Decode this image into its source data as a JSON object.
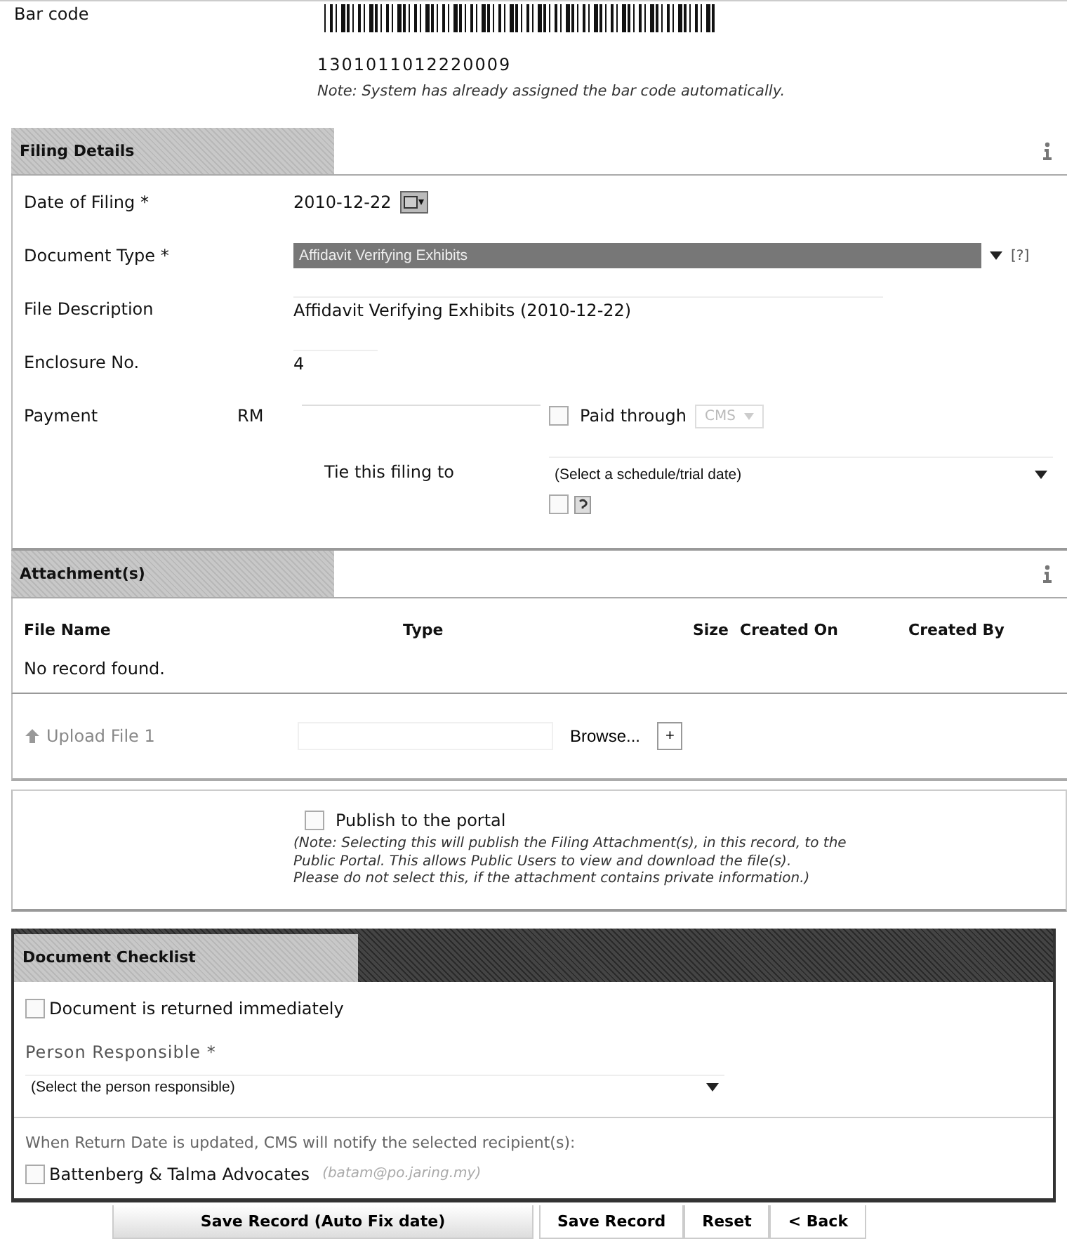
{
  "bar_code": {
    "label": "Bar code",
    "number": "1301011012220009",
    "note": "Note: System has already assigned the bar code automatically."
  },
  "filing_details": {
    "title": "Filing Details",
    "date": {
      "label": "Date of Filing *",
      "value": "2010-12-22"
    },
    "document_type": {
      "label": "Document Type *",
      "value": "Affidavit Verifying Exhibits",
      "help": "[?]"
    },
    "file_description": {
      "label": "File Description",
      "value": "Affidavit Verifying Exhibits (2010-12-22)"
    },
    "enclosure": {
      "label": "Enclosure No.",
      "value": "4"
    },
    "payment": {
      "label": "Payment",
      "currency": "RM",
      "paid_through": {
        "label": "Paid through",
        "checked": false
      },
      "channel": {
        "value": "CMS",
        "disabled": true
      }
    },
    "tie": {
      "label": "Tie this filing to",
      "value": "(Select a schedule/trial date)",
      "checked": false
    }
  },
  "attachments": {
    "title": "Attachment(s)",
    "columns": [
      "File Name",
      "Type",
      "Size",
      "Created On",
      "Created By"
    ],
    "empty": "No record found.",
    "upload": {
      "label": "Upload File 1",
      "browse": "Browse...",
      "add": "+"
    }
  },
  "publish": {
    "label": "Publish to the portal",
    "checked": false,
    "note": [
      "(Note: Selecting this will publish the Filing Attachment(s), in this record, to the",
      "Public Portal. This allows Public Users to view and download the file(s).",
      "Please do not select this, if the attachment contains private information.)"
    ]
  },
  "checklist": {
    "title": "Document Checklist",
    "returned": {
      "label": "Document is returned immediately",
      "checked": false
    },
    "person": {
      "label": "Person Responsible *",
      "value": "(Select the person responsible)"
    },
    "notify": "When Return Date is updated, CMS will notify the selected recipient(s):",
    "recipients": [
      {
        "name": "Battenberg & Talma Advocates",
        "email": "(batam@po.jaring.my)",
        "checked": false
      }
    ]
  },
  "buttons": [
    "Save Record (Auto Fix date)",
    "Save Record",
    "Reset",
    "< Back"
  ]
}
